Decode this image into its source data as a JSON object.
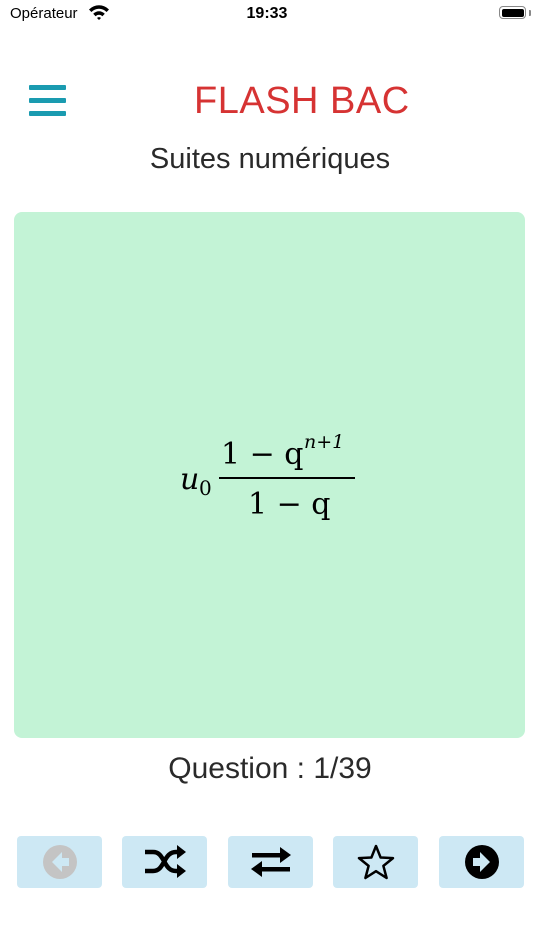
{
  "status_bar": {
    "carrier": "Opérateur",
    "time": "19:33",
    "battery_level": 1.0
  },
  "header": {
    "menu_icon": "hamburger-menu-icon",
    "app_title": "FLASH BAC",
    "subtitle": "Suites numériques"
  },
  "card": {
    "formula": {
      "prefix": "u",
      "prefix_subscript": "0",
      "numerator_base": "1 − q",
      "numerator_exponent": "n+1",
      "denominator": "1 − q"
    },
    "color": "#c3f3d6"
  },
  "counter": {
    "text": "Question : 1/39",
    "current": 1,
    "total": 39
  },
  "toolbar": {
    "buttons": [
      {
        "icon": "previous-arrow-icon",
        "enabled": false
      },
      {
        "icon": "shuffle-icon",
        "enabled": true
      },
      {
        "icon": "swap-arrows-icon",
        "enabled": true
      },
      {
        "icon": "star-icon",
        "enabled": true
      },
      {
        "icon": "next-arrow-icon",
        "enabled": true
      }
    ],
    "button_color": "#cde8f4"
  },
  "colors": {
    "title": "#d63333",
    "menu": "#1a9bb0"
  }
}
